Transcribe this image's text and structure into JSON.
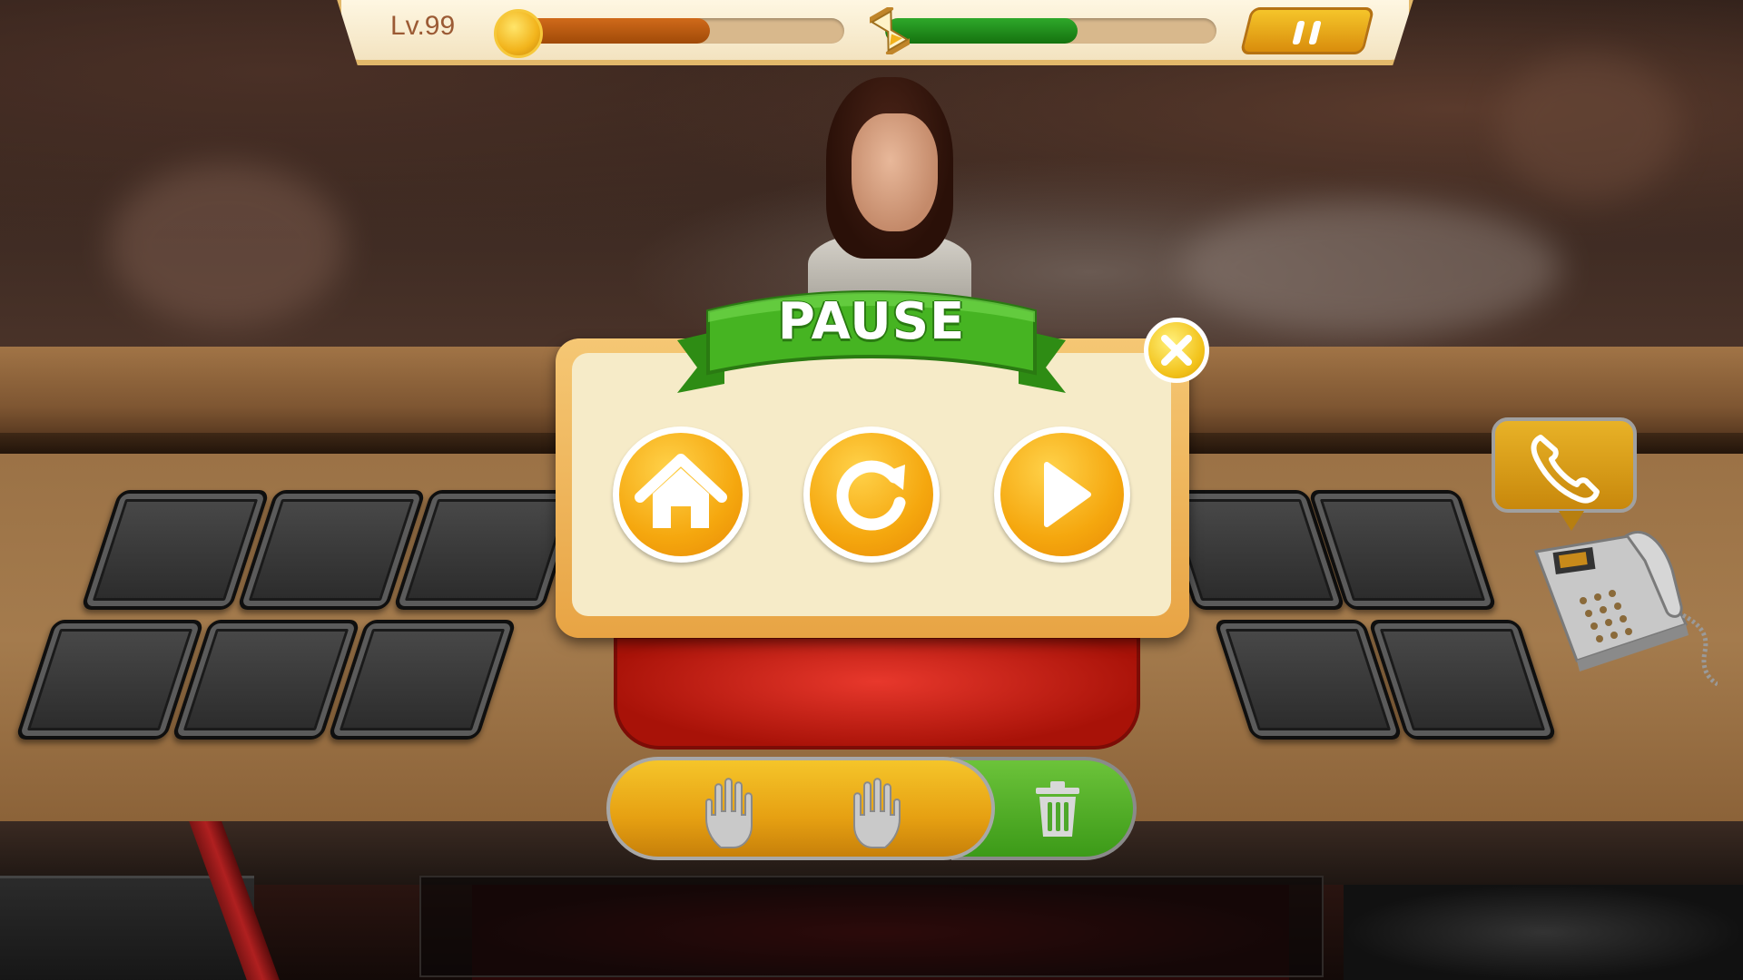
{
  "hud": {
    "level_label": "Lv.99",
    "coin_progress": 0.6,
    "time_progress": 0.58,
    "coin_icon": "coin-icon",
    "time_icon": "hourglass-icon",
    "pause_icon": "pause-icon"
  },
  "dialog": {
    "title": "PAUSE",
    "close_icon": "close-icon",
    "buttons": [
      {
        "name": "home-button",
        "icon": "home-icon"
      },
      {
        "name": "restart-button",
        "icon": "restart-icon"
      },
      {
        "name": "resume-button",
        "icon": "play-icon"
      }
    ]
  },
  "action_bar": {
    "left_icon": "hand-icon",
    "right_icon": "hand-icon",
    "trash_icon": "trash-icon"
  },
  "phone": {
    "bubble_icon": "phone-call-icon"
  },
  "colors": {
    "accent_orange": "#f5a70e",
    "ribbon_green": "#3fa81e",
    "coin_bar": "#b8580c",
    "time_bar": "#1e8a1a",
    "dialog_bg": "#f6ebc8"
  }
}
